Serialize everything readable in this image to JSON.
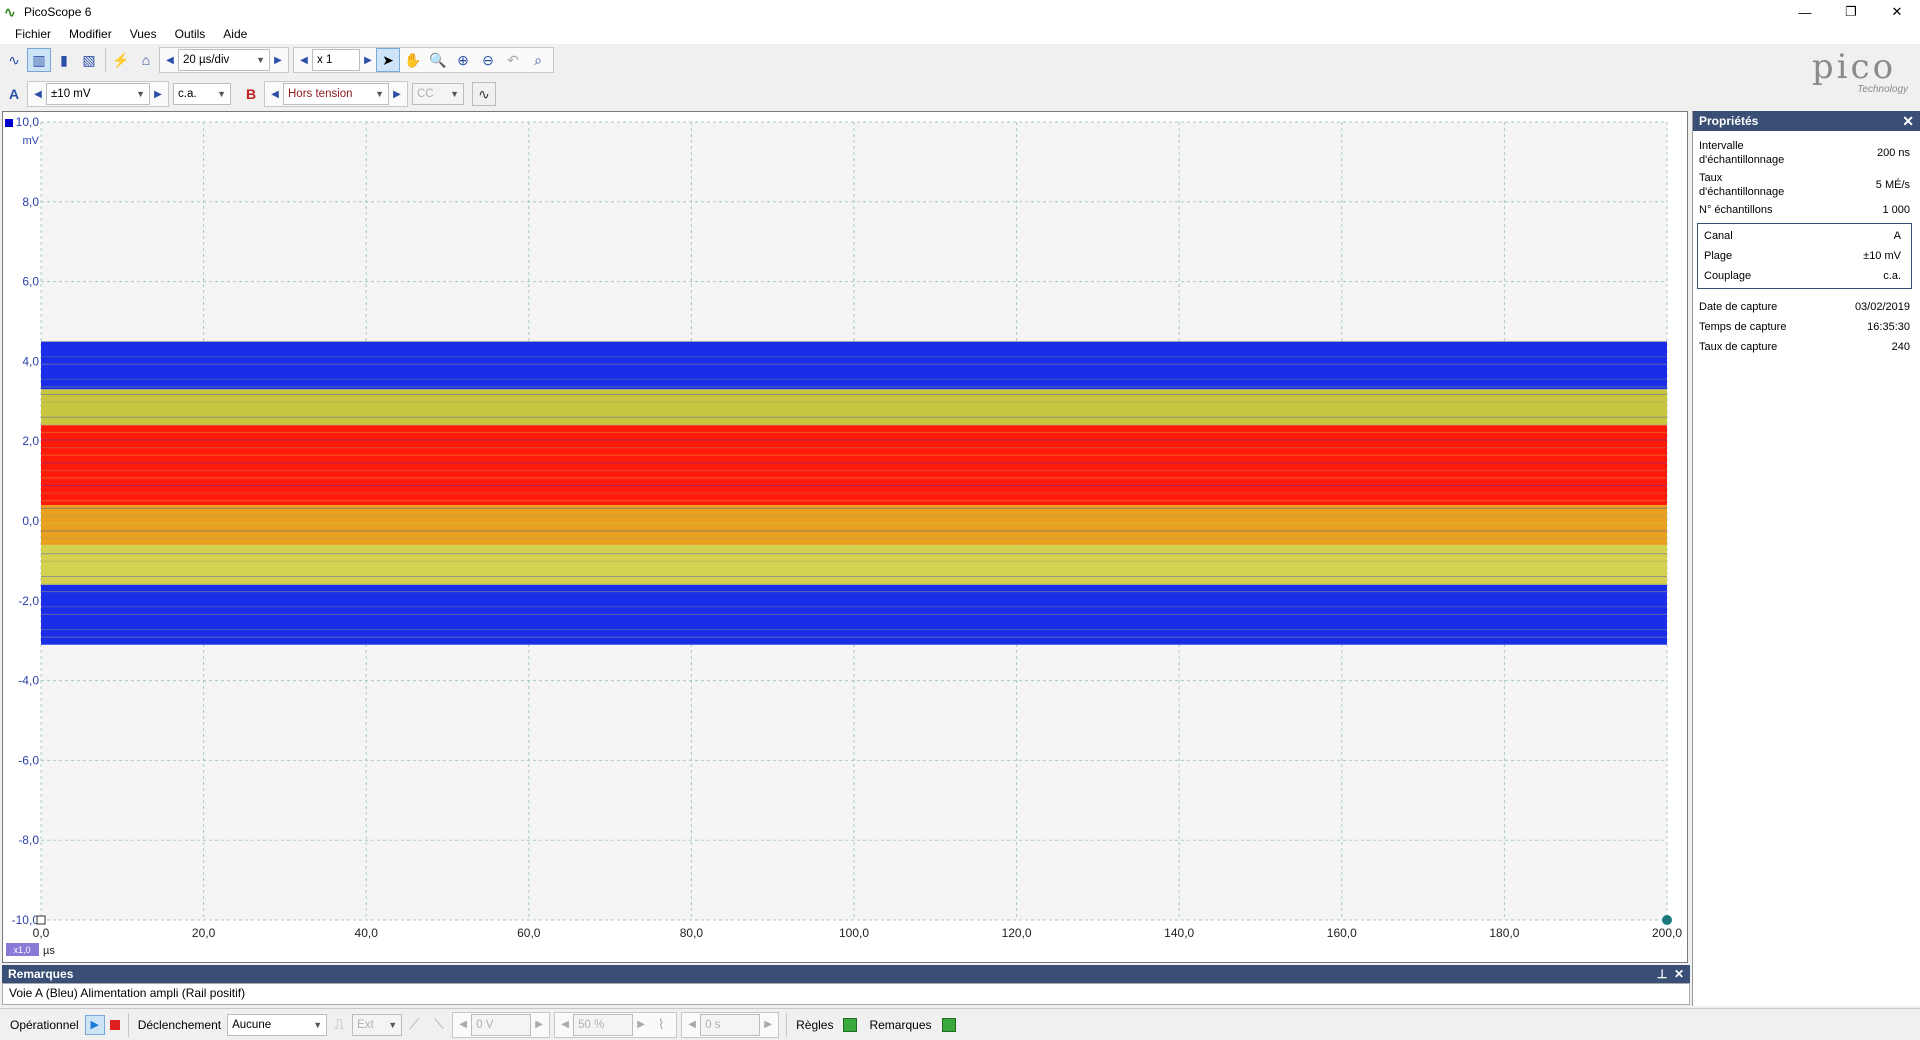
{
  "window": {
    "title": "PicoScope 6",
    "minimize": "—",
    "restore": "❐",
    "close": "✕"
  },
  "menu": [
    "Fichier",
    "Modifier",
    "Vues",
    "Outils",
    "Aide"
  ],
  "toolbar": {
    "timebase": "20 µs/div",
    "zoom": "x 1"
  },
  "channel_a": {
    "label": "A",
    "range": "±10 mV",
    "coupling": "c.a."
  },
  "channel_b": {
    "label": "B",
    "range": "Hors tension",
    "coupling": "CC"
  },
  "logo": {
    "name": "pico",
    "sub": "Technology"
  },
  "properties": {
    "title": "Propriétés",
    "rows": [
      {
        "k": "Intervalle d'échantillonnage",
        "v": "200 ns"
      },
      {
        "k": "Taux d'échantillonnage",
        "v": "5 MÉ/s"
      },
      {
        "k": "N° échantillons",
        "v": "1 000"
      }
    ],
    "box": [
      {
        "k": "Canal",
        "v": "A"
      },
      {
        "k": "Plage",
        "v": "±10 mV"
      },
      {
        "k": "Couplage",
        "v": "c.a."
      }
    ],
    "capture": [
      {
        "k": "Date de capture",
        "v": "03/02/2019"
      },
      {
        "k": "Temps de capture",
        "v": "16:35:30"
      },
      {
        "k": "Taux de capture",
        "v": "240"
      }
    ]
  },
  "remarks": {
    "title": "Remarques",
    "text": "Voie A (Bleu) Alimentation ampli (Rail positif)"
  },
  "status": {
    "mode": "Opérationnel",
    "trigger_label": "Déclenchement",
    "trigger_mode": "Aucune",
    "trigger_source": "Ext",
    "threshold": "0 V",
    "pretrigger": "50 %",
    "delay": "0 s",
    "rules": "Règles",
    "notes": "Remarques"
  },
  "chart_data": {
    "type": "heatmap",
    "description_free": true,
    "x_axis": {
      "unit": "µs",
      "min": 0,
      "max": 200,
      "ticks": [
        "0,0",
        "20,0",
        "40,0",
        "60,0",
        "80,0",
        "100,0",
        "120,0",
        "140,0",
        "160,0",
        "180,0",
        "200,0"
      ]
    },
    "y_axis": {
      "unit": "mV",
      "min": -10,
      "max": 10,
      "ticks": [
        "10,0",
        "8,0",
        "6,0",
        "4,0",
        "2,0",
        "0,0",
        "-2,0",
        "-4,0",
        "-6,0",
        "-8,0",
        "-10,0"
      ]
    },
    "x_scale_badge": "x1,0",
    "grid": true,
    "bands": [
      {
        "y_top": 4.5,
        "y_bottom": 3.3,
        "color": "#1a2ee8"
      },
      {
        "y_top": 3.3,
        "y_bottom": 2.4,
        "color": "#c8c640"
      },
      {
        "y_top": 2.4,
        "y_bottom": 0.4,
        "color": "#ff1a0a"
      },
      {
        "y_top": 0.4,
        "y_bottom": -0.6,
        "color": "#e8a020"
      },
      {
        "y_top": -0.6,
        "y_bottom": -1.6,
        "color": "#d4d050"
      },
      {
        "y_top": -1.6,
        "y_bottom": -3.1,
        "color": "#1a2ee8"
      }
    ],
    "colors": {
      "blue": "#1a2ee8",
      "yellow": "#d4d050",
      "red": "#ff1a0a"
    }
  }
}
